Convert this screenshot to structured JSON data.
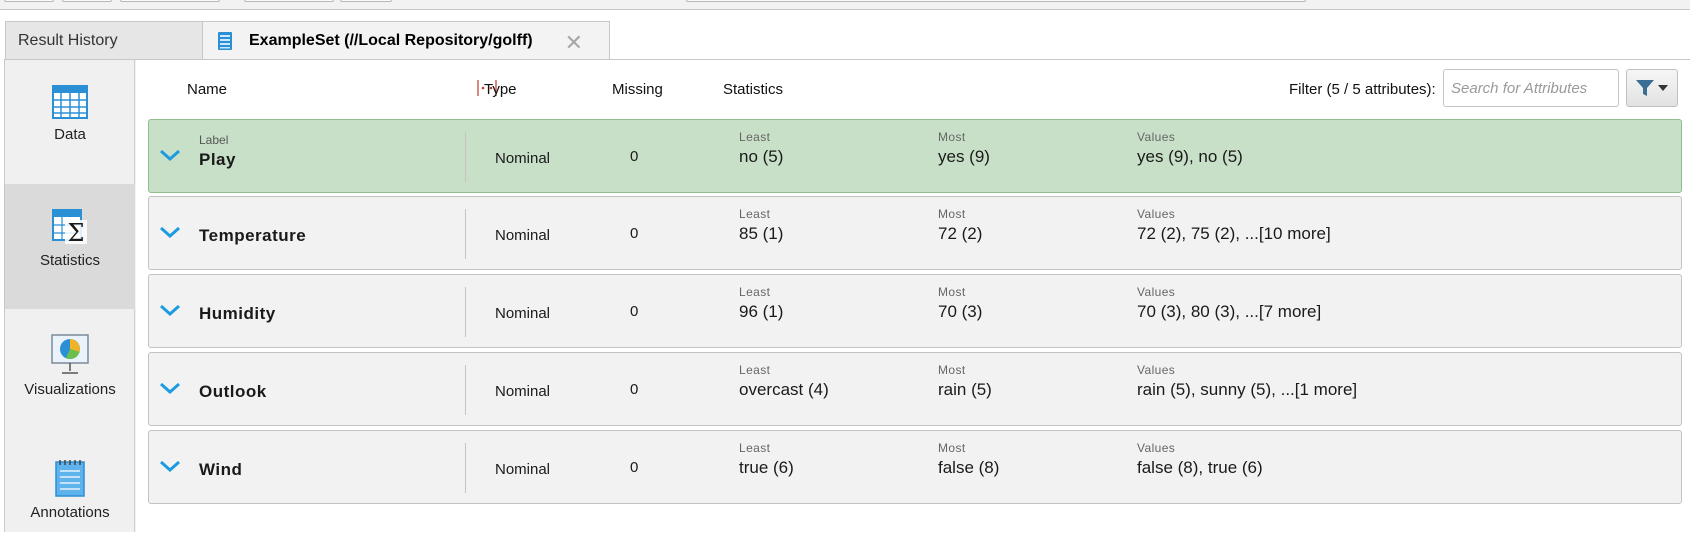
{
  "tabs": {
    "result_history": "Result History",
    "example_set": "ExampleSet (//Local Repository/golff)",
    "close_glyph": "✕"
  },
  "sidebar": {
    "items": [
      {
        "label": "Data",
        "icon": "data-table-icon"
      },
      {
        "label": "Statistics",
        "icon": "statistics-sigma-icon",
        "selected": true
      },
      {
        "label": "Visualizations",
        "icon": "visualizations-chart-icon"
      },
      {
        "label": "Annotations",
        "icon": "annotations-notepad-icon"
      }
    ]
  },
  "header": {
    "name": "Name",
    "type": "Type",
    "missing": "Missing",
    "statistics": "Statistics",
    "filter_label": "Filter (5 / 5 attributes):",
    "search_placeholder": "Search for Attributes"
  },
  "stat_labels": {
    "least": "Least",
    "most": "Most",
    "values": "Values"
  },
  "attributes": [
    {
      "role": "Label",
      "name": "Play",
      "type": "Nominal",
      "missing": "0",
      "least": "no (5)",
      "most": "yes (9)",
      "values": "yes (9), no (5)"
    },
    {
      "role": "",
      "name": "Temperature",
      "type": "Nominal",
      "missing": "0",
      "least": "85 (1)",
      "most": "72 (2)",
      "values": "72 (2), 75 (2), ...[10 more]"
    },
    {
      "role": "",
      "name": "Humidity",
      "type": "Nominal",
      "missing": "0",
      "least": "96 (1)",
      "most": "70 (3)",
      "values": "70 (3), 80 (3), ...[7 more]"
    },
    {
      "role": "",
      "name": "Outlook",
      "type": "Nominal",
      "missing": "0",
      "least": "overcast (4)",
      "most": "rain (5)",
      "values": "rain (5), sunny (5), ...[1 more]"
    },
    {
      "role": "",
      "name": "Wind",
      "type": "Nominal",
      "missing": "0",
      "least": "true (6)",
      "most": "false (8)",
      "values": "false (8), true (6)"
    }
  ],
  "colors": {
    "label_row_bg": "#c8e0c8",
    "row_bg": "#f2f2f2",
    "chevron": "#1e9be0",
    "sidebar_selected": "#dadada"
  }
}
